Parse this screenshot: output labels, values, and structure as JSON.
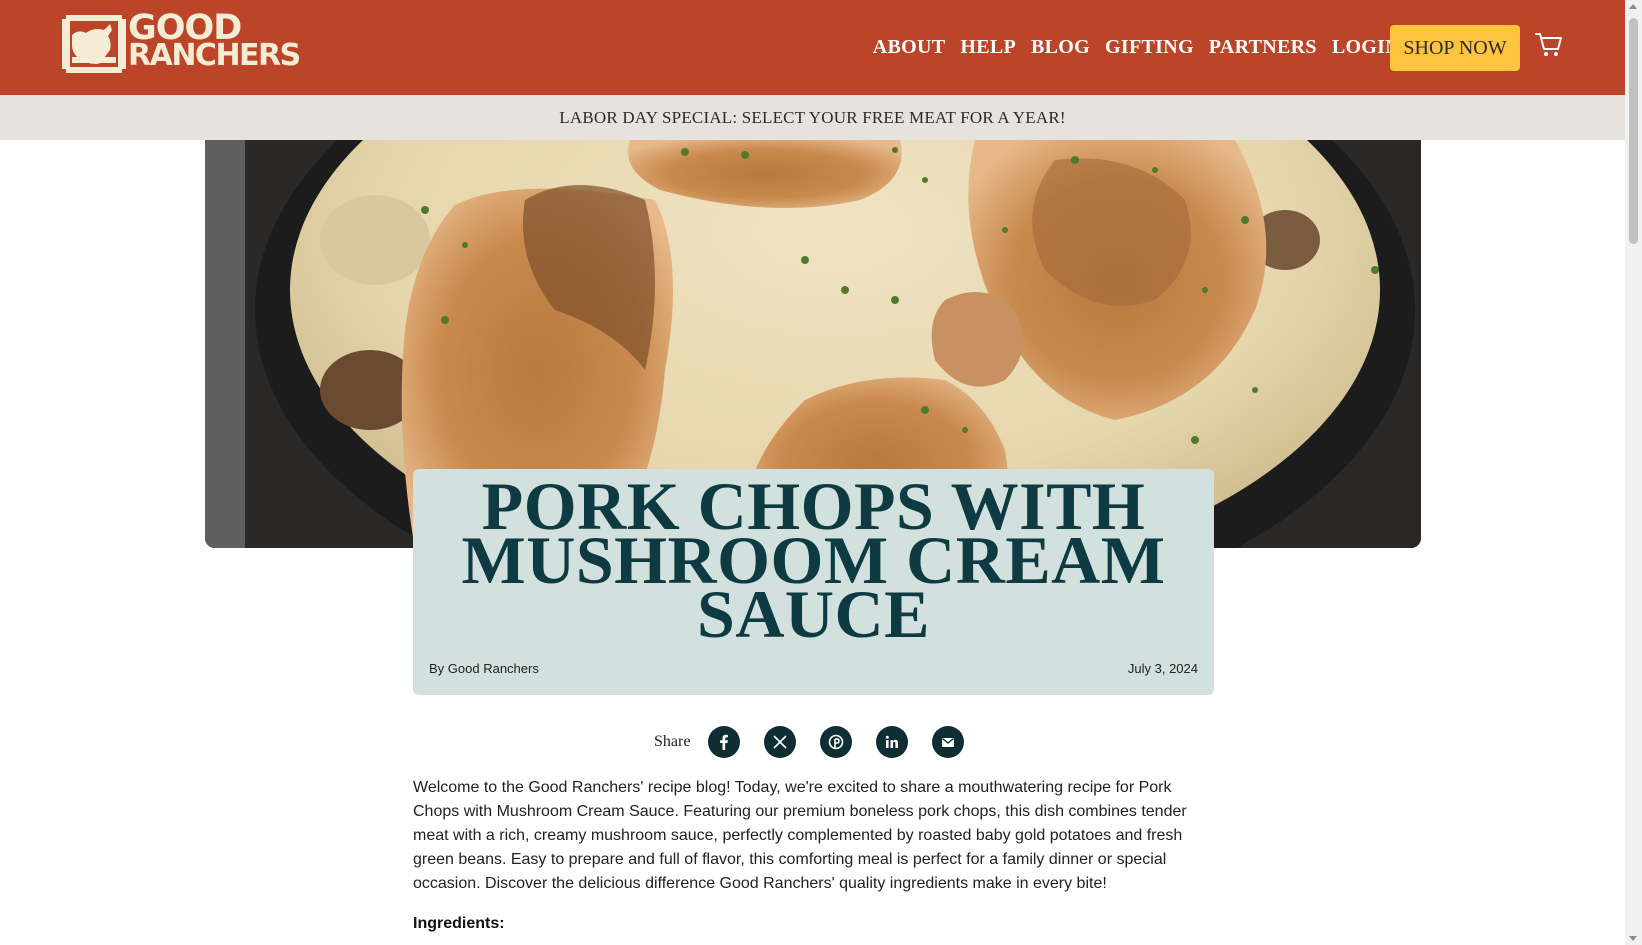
{
  "brand": {
    "logo_line1": "GOOD",
    "logo_line2": "RANCHERS",
    "primary_color": "#bc4529",
    "accent_color": "#ffc43d",
    "cream_color": "#f5ecd6"
  },
  "nav": {
    "items": [
      {
        "label": "ABOUT"
      },
      {
        "label": "HELP"
      },
      {
        "label": "BLOG"
      },
      {
        "label": "GIFTING"
      },
      {
        "label": "PARTNERS"
      },
      {
        "label": "LOGIN"
      }
    ],
    "shop_now": "SHOP NOW",
    "cart_icon": "cart-icon"
  },
  "promo": {
    "text": "LABOR DAY SPECIAL: SELECT YOUR FREE MEAT FOR A YEAR!"
  },
  "article": {
    "title": "PORK CHOPS WITH MUSHROOM CREAM SAUCE",
    "byline": "By Good Ranchers",
    "date": "July 3, 2024",
    "share_label": "Share",
    "share_icons": [
      "facebook-icon",
      "x-icon",
      "pinterest-icon",
      "linkedin-icon",
      "email-icon"
    ],
    "intro": "Welcome to the Good Ranchers' recipe blog! Today, we're excited to share a mouthwatering recipe for Pork Chops with Mushroom Cream Sauce. Featuring our premium boneless pork chops, this dish combines tender meat with a rich, creamy mushroom sauce, perfectly complemented by roasted baby gold potatoes and fresh green beans. Easy to prepare and full of flavor, this comforting meal is perfect for a family dinner or special occasion. Discover the delicious difference Good Ranchers' quality ingredients make in every bite!",
    "ingredients_heading": "Ingredients:"
  }
}
